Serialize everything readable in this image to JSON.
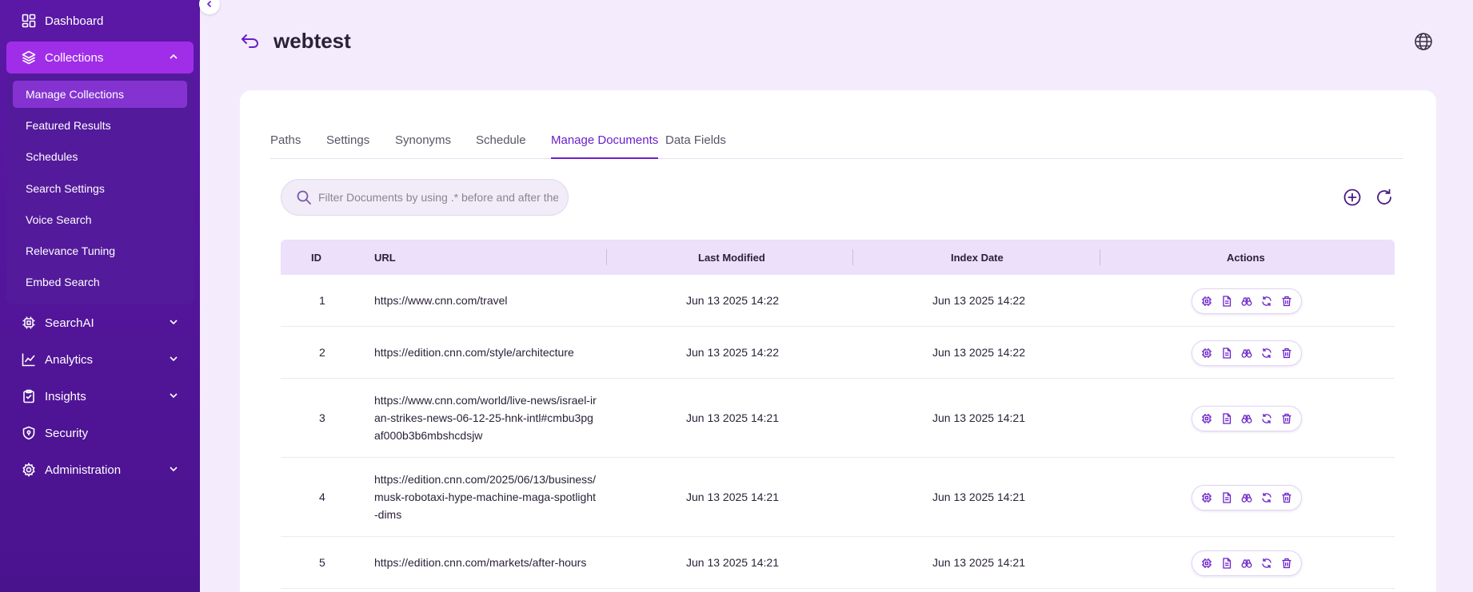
{
  "sidebar": {
    "dashboard": "Dashboard",
    "collections": "Collections",
    "sub_items": [
      {
        "label": "Manage Collections"
      },
      {
        "label": "Featured Results"
      },
      {
        "label": "Schedules"
      },
      {
        "label": "Search Settings"
      },
      {
        "label": "Voice Search"
      },
      {
        "label": "Relevance Tuning"
      },
      {
        "label": "Embed Search"
      }
    ],
    "searchai": "SearchAI",
    "analytics": "Analytics",
    "insights": "Insights",
    "security": "Security",
    "administration": "Administration"
  },
  "header": {
    "title": "webtest"
  },
  "tabs": [
    "Paths",
    "Settings",
    "Synonyms",
    "Schedule",
    "Manage Documents",
    "Data Fields"
  ],
  "active_tab": "Manage Documents",
  "search": {
    "placeholder": "Filter Documents by using .* before and after the"
  },
  "table": {
    "headers": {
      "id": "ID",
      "url": "URL",
      "last_modified": "Last Modified",
      "index_date": "Index Date",
      "actions": "Actions"
    },
    "rows": [
      {
        "id": "1",
        "url": "https://www.cnn.com/travel",
        "last_modified": "Jun 13 2025 14:22",
        "index_date": "Jun 13 2025 14:22"
      },
      {
        "id": "2",
        "url": "https://edition.cnn.com/style/architecture",
        "last_modified": "Jun 13 2025 14:22",
        "index_date": "Jun 13 2025 14:22"
      },
      {
        "id": "3",
        "url": "https://www.cnn.com/world/live-news/israel-iran-strikes-news-06-12-25-hnk-intl#cmbu3pgaf000b3b6mbshcdsjw",
        "last_modified": "Jun 13 2025 14:21",
        "index_date": "Jun 13 2025 14:21"
      },
      {
        "id": "4",
        "url": "https://edition.cnn.com/2025/06/13/business/musk-robotaxi-hype-machine-maga-spotlight-dims",
        "last_modified": "Jun 13 2025 14:21",
        "index_date": "Jun 13 2025 14:21"
      },
      {
        "id": "5",
        "url": "https://edition.cnn.com/markets/after-hours",
        "last_modified": "Jun 13 2025 14:21",
        "index_date": "Jun 13 2025 14:21"
      }
    ]
  },
  "colors": {
    "sidebar": "#5b18a6",
    "accent": "#6a1fc9",
    "active_nav": "#a02ee8",
    "table_header": "#ede0fb",
    "background": "#f4ecfc"
  },
  "icons": {
    "row_actions": [
      "chip-icon",
      "document-icon",
      "binoculars-icon",
      "refresh-icon",
      "trash-icon"
    ]
  }
}
